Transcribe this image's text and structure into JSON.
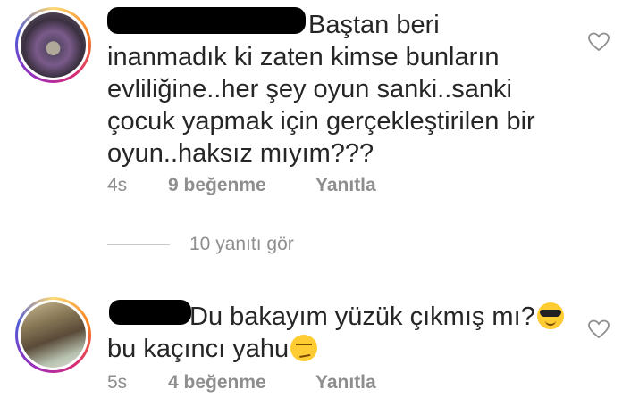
{
  "comments": [
    {
      "text_line1": "Baştan beri",
      "text_rest": "inanmadık ki zaten kimse bunların\nevliliğine..her şey oyun sanki..sanki\nçocuk yapmak için gerçekleştirilen bir\noyun..haksız mıyım???",
      "time": "4s",
      "likes": "9 beğenme",
      "reply": "Yanıtla",
      "icons": {
        "like": "heart-outline-icon"
      }
    },
    {
      "text_line1": "Du bakayım yüzük çıkmış mı?",
      "text_line2": "bu kaçıncı yahu",
      "time": "5s",
      "likes": "4 beğenme",
      "reply": "Yanıtla",
      "icons": {
        "emoji1": "sunglasses-emoji",
        "emoji2": "smirk-emoji",
        "like": "heart-outline-icon"
      }
    }
  ],
  "view_replies": "10 yanıtı gör"
}
